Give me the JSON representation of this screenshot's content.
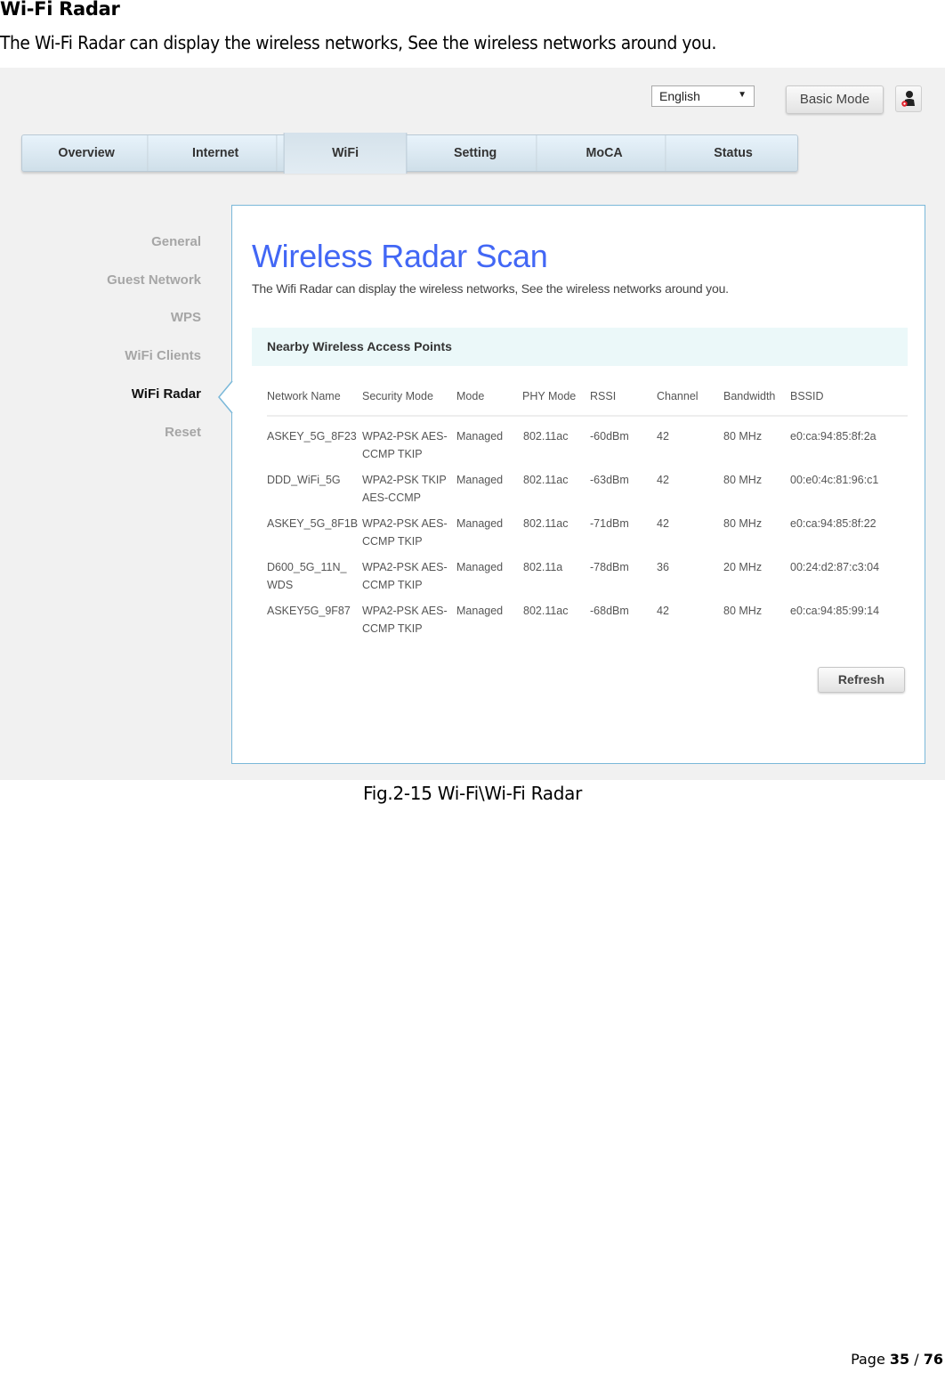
{
  "document": {
    "heading": "Wi-Fi Radar",
    "intro": "The Wi-Fi Radar can display the wireless networks, See the wireless networks around you.",
    "caption": "Fig.2-15 Wi-Fi\\Wi-Fi Radar",
    "page_label": "Page",
    "page_current": "35",
    "page_separator": "/",
    "page_total": "76"
  },
  "topbar": {
    "language": "English",
    "language_arrow": "▼",
    "basic_mode_label": "Basic Mode",
    "user_icon": "user-logout-icon"
  },
  "nav": {
    "tabs": [
      {
        "label": "Overview"
      },
      {
        "label": "Internet"
      },
      {
        "label": "WiFi",
        "active": true
      },
      {
        "label": "Setting"
      },
      {
        "label": "MoCA"
      },
      {
        "label": "Status"
      }
    ]
  },
  "sidebar": {
    "items": [
      {
        "label": "General"
      },
      {
        "label": "Guest Network"
      },
      {
        "label": "WPS"
      },
      {
        "label": "WiFi Clients"
      },
      {
        "label": "WiFi Radar",
        "active": true
      },
      {
        "label": "Reset"
      }
    ]
  },
  "panel": {
    "title": "Wireless Radar Scan",
    "description": "The Wifi Radar can display the wireless networks, See the wireless networks around you.",
    "section_title": "Nearby Wireless Access Points",
    "columns": [
      "Network Name",
      "Security Mode",
      "Mode",
      "PHY Mode",
      "RSSI",
      "Channel",
      "Bandwidth",
      "BSSID"
    ],
    "rows": [
      {
        "name": [
          "ASKEY_5G_8F23",
          ""
        ],
        "security": [
          "WPA2-PSK AES-",
          "CCMP TKIP"
        ],
        "mode": "Managed",
        "phy": "802.11ac",
        "rssi": "-60dBm",
        "channel": "42",
        "bandwidth": "80 MHz",
        "bssid": "e0:ca:94:85:8f:2a"
      },
      {
        "name": [
          "DDD_WiFi_5G",
          ""
        ],
        "security": [
          "WPA2-PSK TKIP",
          "AES-CCMP"
        ],
        "mode": "Managed",
        "phy": "802.11ac",
        "rssi": "-63dBm",
        "channel": "42",
        "bandwidth": "80 MHz",
        "bssid": "00:e0:4c:81:96:c1"
      },
      {
        "name": [
          "ASKEY_5G_8F1B",
          ""
        ],
        "security": [
          "WPA2-PSK AES-",
          "CCMP TKIP"
        ],
        "mode": "Managed",
        "phy": "802.11ac",
        "rssi": "-71dBm",
        "channel": "42",
        "bandwidth": "80 MHz",
        "bssid": "e0:ca:94:85:8f:22"
      },
      {
        "name": [
          "D600_5G_11N_",
          "WDS"
        ],
        "security": [
          "WPA2-PSK AES-",
          "CCMP TKIP"
        ],
        "mode": "Managed",
        "phy": "802.11a",
        "rssi": "-78dBm",
        "channel": "36",
        "bandwidth": "20 MHz",
        "bssid": "00:24:d2:87:c3:04"
      },
      {
        "name": [
          "ASKEY5G_9F87",
          ""
        ],
        "security": [
          "WPA2-PSK AES-",
          "CCMP TKIP"
        ],
        "mode": "Managed",
        "phy": "802.11ac",
        "rssi": "-68dBm",
        "channel": "42",
        "bandwidth": "80 MHz",
        "bssid": "e0:ca:94:85:99:14"
      }
    ],
    "refresh_label": "Refresh"
  },
  "colors": {
    "title_blue": "#4267f5",
    "panel_border": "#7ab8d9",
    "section_bg": "#ebf8f9",
    "page_bg": "#f1f1f1"
  }
}
